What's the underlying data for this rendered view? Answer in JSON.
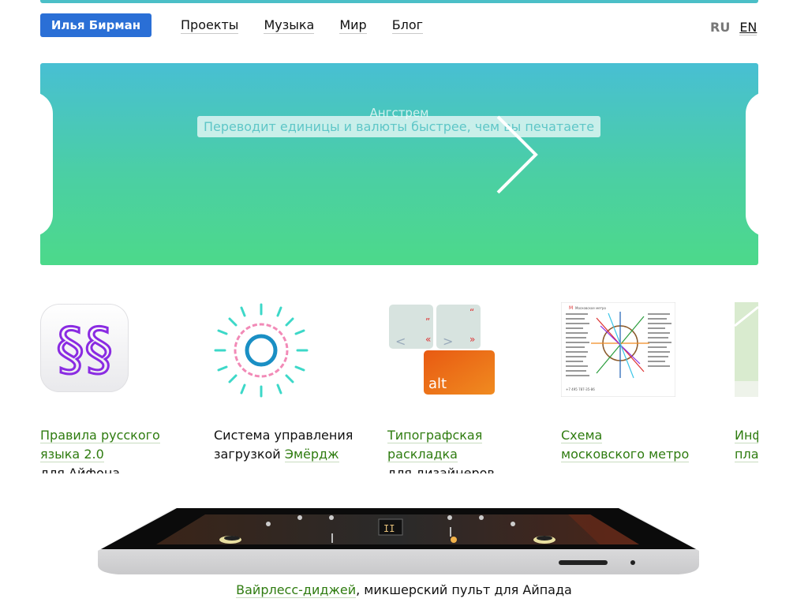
{
  "header": {
    "brand": "Илья Бирман",
    "nav": [
      "Проекты",
      "Музыка",
      "Мир",
      "Блог"
    ],
    "lang": {
      "ru": "RU",
      "en": "EN"
    }
  },
  "banner": {
    "ghost_title": "Ангстрем",
    "tagline": "Переводит единицы и валюты быстрее, чем вы печатаете"
  },
  "projects": [
    {
      "link": "Правила русского языка 2.0",
      "link_lines": [
        "Правила русского",
        "языка 2.0"
      ],
      "suffix": "для Айфона"
    },
    {
      "prefix_lines": [
        "Система управления",
        "загрузкой "
      ],
      "link": "Эмёрдж"
    },
    {
      "link_lines": [
        "Типографская",
        "раскладка"
      ],
      "suffix": "для дизайнеров"
    },
    {
      "link_lines": [
        "Схема",
        "московского метро"
      ]
    },
    {
      "link_lines": [
        "Инф",
        "пла"
      ]
    }
  ],
  "layout_keys": {
    "alt_key": "alt"
  },
  "metro": {
    "title": "Московское метро",
    "phone": "+7 495 787-35-86"
  },
  "footer": {
    "link": "Вайрлесс-диджей",
    "rest": ", микшерский пульт для Айпада"
  },
  "colors": {
    "brand_bg": "#2a6fd6",
    "link": "#2f7c10",
    "banner_top": "#48bfd3",
    "banner_bottom": "#4cd98a"
  }
}
